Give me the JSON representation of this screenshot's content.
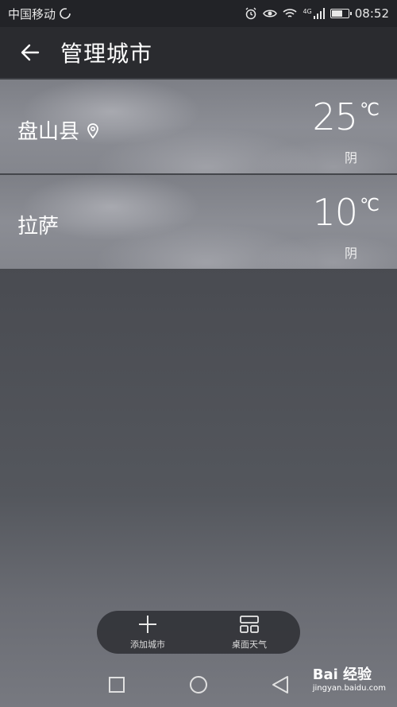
{
  "status": {
    "carrier": "中国移动",
    "network": "4G",
    "time": "08:52"
  },
  "header": {
    "title": "管理城市"
  },
  "cities": [
    {
      "name": "盘山县",
      "temp": "25",
      "unit": "℃",
      "condition": "阴",
      "location": true
    },
    {
      "name": "拉萨",
      "temp": "10",
      "unit": "℃",
      "condition": "阴",
      "location": false
    }
  ],
  "actions": {
    "add_city": "添加城市",
    "desktop_weather": "桌面天气"
  },
  "watermark": {
    "brand": "Bai 经验",
    "url": "jingyan.baidu.com"
  },
  "battery_level": 0.6
}
